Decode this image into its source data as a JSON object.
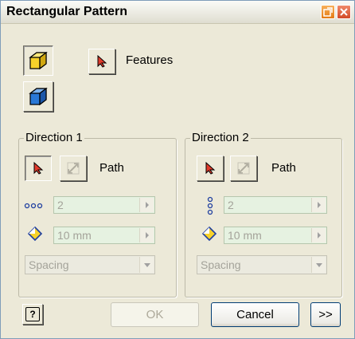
{
  "window": {
    "title": "Rectangular Pattern"
  },
  "features": {
    "label": "Features"
  },
  "direction1": {
    "title": "Direction 1",
    "path_label": "Path",
    "count": "2",
    "spacing_value": "10 mm",
    "method": "Spacing"
  },
  "direction2": {
    "title": "Direction 2",
    "path_label": "Path",
    "count": "2",
    "spacing_value": "10 mm",
    "method": "Spacing"
  },
  "footer": {
    "ok_label": "OK",
    "cancel_label": "Cancel",
    "more_label": ">>",
    "help_label": "?"
  },
  "colors": {
    "accent": "#d23a2a",
    "field_bg": "#e6f2e1",
    "dialog_bg": "#ece9d8"
  }
}
